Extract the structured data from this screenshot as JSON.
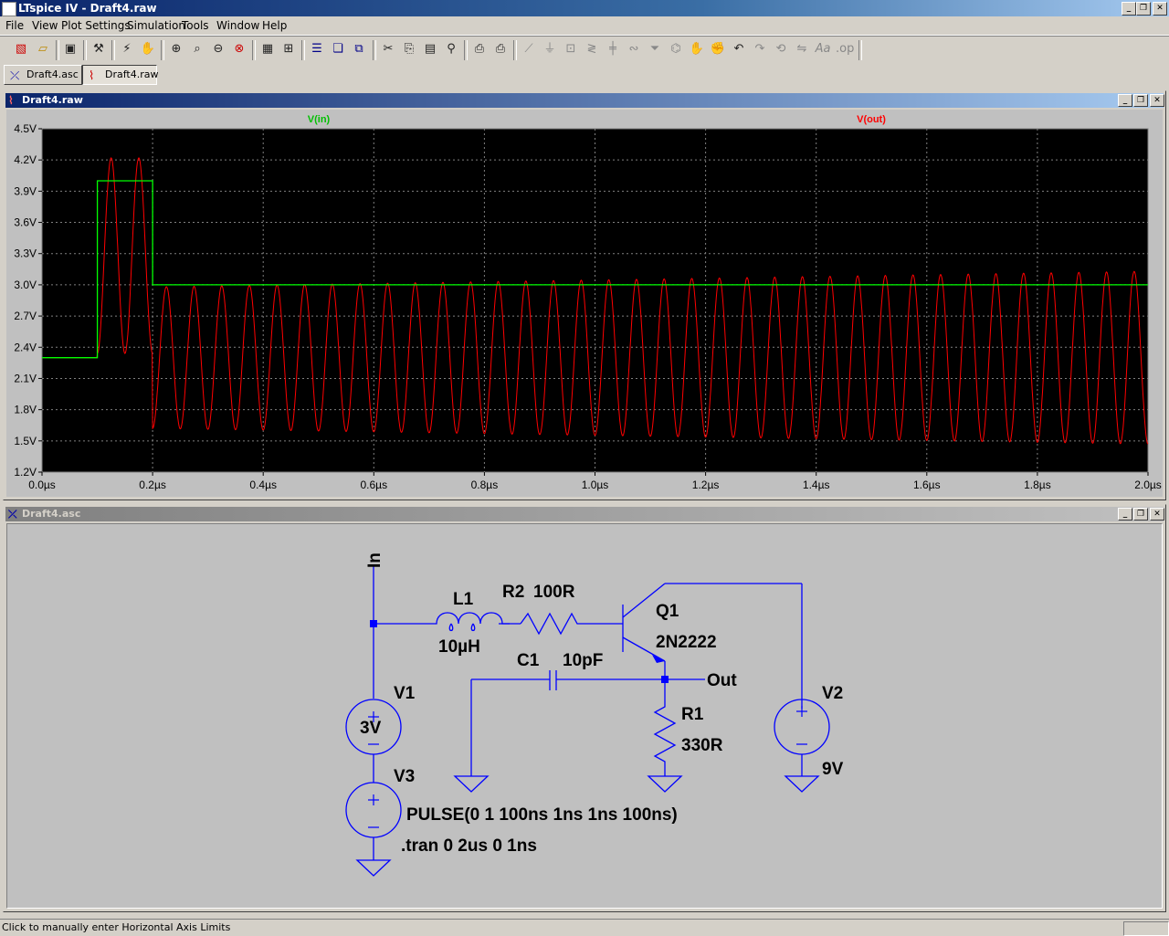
{
  "app": {
    "title": "LTspice IV - Draft4.raw"
  },
  "menu": [
    "File",
    "View",
    "Plot Settings",
    "Simulation",
    "Tools",
    "Window",
    "Help"
  ],
  "tabs": [
    {
      "label": "Draft4.asc",
      "active": false,
      "icon": "schematic-icon"
    },
    {
      "label": "Draft4.raw",
      "active": true,
      "icon": "waveform-icon"
    }
  ],
  "plot_window": {
    "title": "Draft4.raw"
  },
  "schematic_window": {
    "title": "Draft4.asc"
  },
  "chart_data": {
    "type": "line",
    "title": "",
    "xlabel": "",
    "ylabel": "",
    "xlim": [
      0,
      2.0
    ],
    "ylim": [
      1.2,
      4.5
    ],
    "x_ticks": [
      "0.0µs",
      "0.2µs",
      "0.4µs",
      "0.6µs",
      "0.8µs",
      "1.0µs",
      "1.2µs",
      "1.4µs",
      "1.6µs",
      "1.8µs",
      "2.0µs"
    ],
    "y_ticks": [
      "1.2V",
      "1.5V",
      "1.8V",
      "2.1V",
      "2.4V",
      "2.7V",
      "3.0V",
      "3.3V",
      "3.6V",
      "3.9V",
      "4.2V",
      "4.5V"
    ],
    "grid": true,
    "background": "#000000",
    "series": [
      {
        "name": "V(in)",
        "color": "#00ff00",
        "x": [
          0,
          0.1,
          0.1,
          0.2,
          0.2,
          2.0
        ],
        "values": [
          2.3,
          2.3,
          4.0,
          4.0,
          3.0,
          3.0
        ]
      },
      {
        "name": "V(out)",
        "color": "#ff0000",
        "description_points": {
          "x": [
            0,
            0.1,
            0.125,
            0.15,
            0.175,
            0.2,
            0.25,
            1.0,
            2.0
          ],
          "values": [
            2.3,
            2.3,
            4.22,
            2.35,
            4.22,
            2.4,
            1.62,
            1.52,
            1.48
          ]
        },
        "oscillation_period_us": 0.05,
        "center_v": 2.3,
        "start_amplitude_v": 0.68,
        "end_amplitude_v": 0.83
      }
    ]
  },
  "schematic": {
    "labels": {
      "in": "In",
      "l1": "L1",
      "l1_val": "10µH",
      "r2": "R2",
      "r2_val": "100R",
      "q1": "Q1",
      "q1_val": "2N2222",
      "c1": "C1",
      "c1_val": "10pF",
      "out": "Out",
      "r1": "R1",
      "r1_val": "330R",
      "v1": "V1",
      "v1_val": "3V",
      "v2": "V2",
      "v2_val": "9V",
      "v3": "V3",
      "v3_val": "PULSE(0 1 100ns 1ns 1ns 100ns)",
      "directive": ".tran 0 2us 0 1ns"
    },
    "wire_color": "#0000ff"
  },
  "status": {
    "text": "Click to manually enter Horizontal Axis Limits"
  }
}
